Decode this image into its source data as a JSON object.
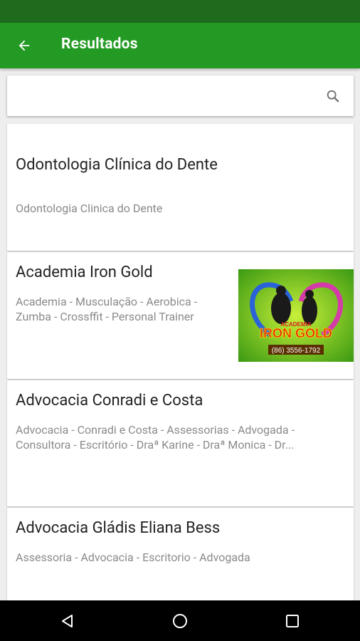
{
  "header": {
    "title": "Resultados",
    "back_icon": "arrow-back-icon"
  },
  "search": {
    "value": "",
    "placeholder": "",
    "icon": "search-icon"
  },
  "results": [
    {
      "title": "Odontologia Clínica do Dente",
      "description": "Odontologia Clinica do Dente",
      "has_image": false
    },
    {
      "title": "Academia Iron Gold",
      "description_lines": [
        "Academia - Musculação - Aerobica -",
        "Zumba - Crossffit - Personal Trainer"
      ],
      "has_image": true,
      "image": {
        "top_text": "ACADEMIA",
        "brand": "IRON GOLD",
        "phone": "(86) 3556-1792"
      }
    },
    {
      "title": "Advocacia Conradi e Costa",
      "description_lines": [
        "Advocacia - Conradi e Costa - Assessorias - Advogada -",
        "Consultora - Escritório - Draª Karine - Draª Monica - Dr..."
      ],
      "has_image": false
    },
    {
      "title": "Advocacia Gládis Eliana Bess",
      "description": "Assessoria - Advocacia - Escritorio - Advogada",
      "has_image": false
    }
  ],
  "navigation": {
    "back": "triangle-back-icon",
    "home": "circle-home-icon",
    "recents": "square-recents-icon"
  },
  "colors": {
    "status_bar": "#1e6b1e",
    "app_bar": "#239a23",
    "text_primary": "#222222",
    "text_secondary": "#8a8a8a"
  }
}
